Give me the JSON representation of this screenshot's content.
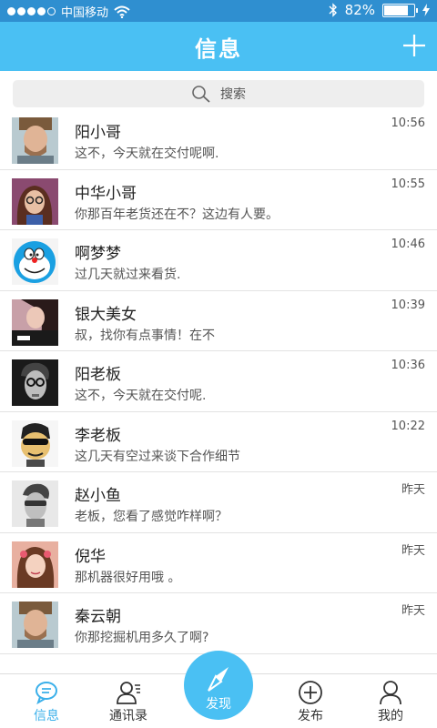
{
  "status_bar": {
    "carrier": "中国移动",
    "battery": "82%"
  },
  "header": {
    "title": "信息"
  },
  "search": {
    "placeholder": "搜索"
  },
  "conversations": [
    {
      "name": "阳小哥",
      "message": "这不，今天就在交付呢啊.",
      "time": "10:56"
    },
    {
      "name": "中华小哥",
      "message": "你那百年老货还在不？这边有人要。",
      "time": "10:55"
    },
    {
      "name": "啊梦梦",
      "message": "过几天就过来看货.",
      "time": "10:46"
    },
    {
      "name": "银大美女",
      "message": "叔，找你有点事情！在不",
      "time": "10:39"
    },
    {
      "name": "阳老板",
      "message": "这不，今天就在交付呢.",
      "time": "10:36"
    },
    {
      "name": "李老板",
      "message": "这几天有空过来谈下合作细节",
      "time": "10:22"
    },
    {
      "name": "赵小鱼",
      "message": "老板，您看了感觉咋样啊？",
      "time": "昨天"
    },
    {
      "name": "倪华",
      "message": "那机器很好用哦 。",
      "time": "昨天"
    },
    {
      "name": "秦云朝",
      "message": "你那挖掘机用多久了啊?",
      "time": "昨天"
    }
  ],
  "tabbar": {
    "messages": "信息",
    "contacts": "通讯录",
    "discover": "发现",
    "publish": "发布",
    "mine": "我的"
  },
  "colors": {
    "accent": "#4ac0f3",
    "status_bar": "#2f8fd0",
    "active_tab": "#3bb0ea"
  }
}
